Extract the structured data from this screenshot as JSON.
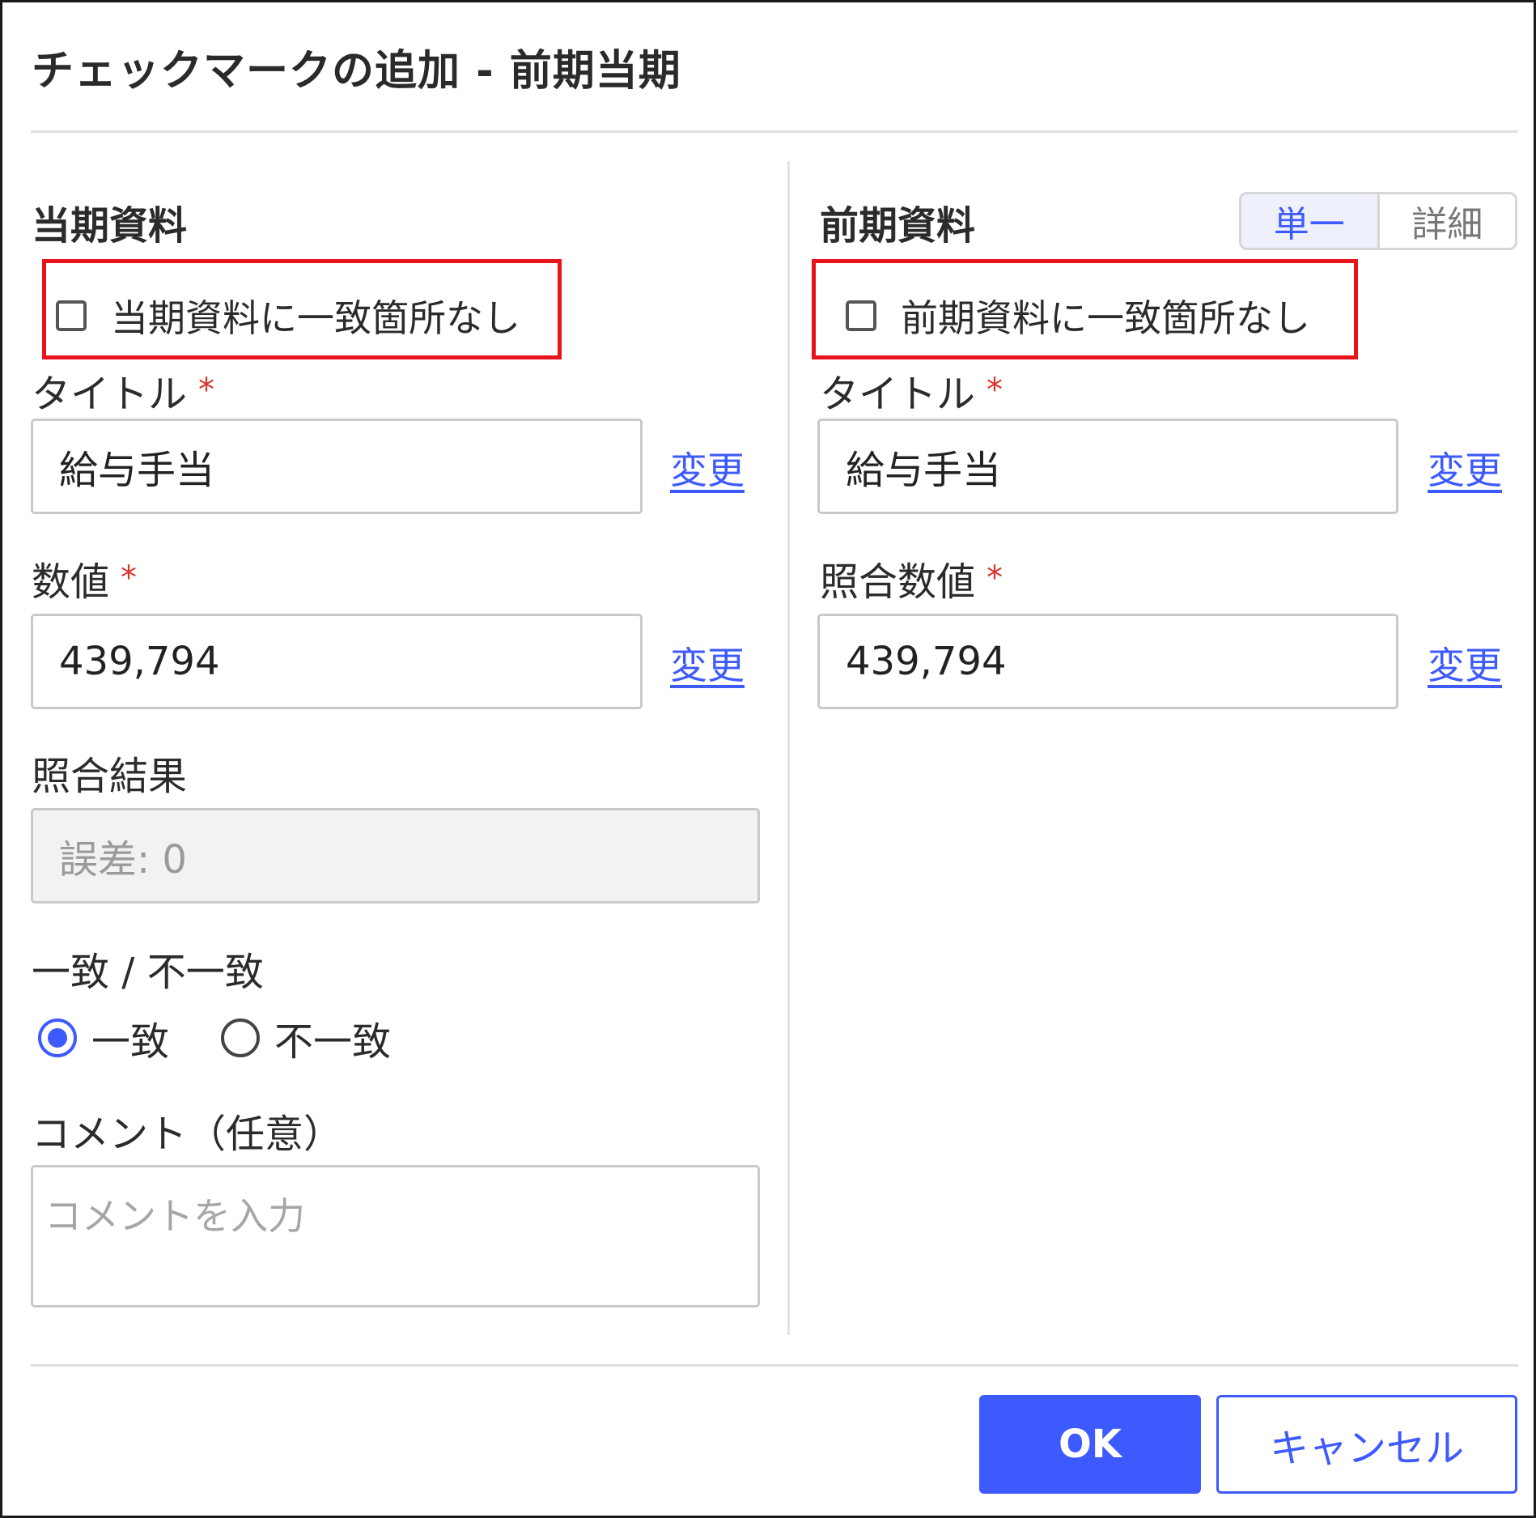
{
  "dialog": {
    "title": "チェックマークの追加 - 前期当期",
    "ok_label": "OK",
    "cancel_label": "キャンセル"
  },
  "current": {
    "section_title": "当期資料",
    "no_match_label": "当期資料に一致箇所なし",
    "title_label": "タイトル",
    "title_value": "給与手当",
    "title_change_link": "変更",
    "value_label": "数値",
    "value_value": "439,794",
    "value_change_link": "変更",
    "result_label": "照合結果",
    "result_value": "誤差: 0",
    "match_group_label": "一致 / 不一致",
    "match_options": [
      "一致",
      "不一致"
    ],
    "match_selected": "一致",
    "comment_label": "コメント（任意）",
    "comment_placeholder": "コメントを入力"
  },
  "previous": {
    "section_title": "前期資料",
    "mode_toggle": [
      "単一",
      "詳細"
    ],
    "mode_selected": "単一",
    "no_match_label": "前期資料に一致箇所なし",
    "title_label": "タイトル",
    "title_value": "給与手当",
    "title_change_link": "変更",
    "value_label": "照合数値",
    "value_value": "439,794",
    "value_change_link": "変更"
  },
  "required_mark": "*",
  "colors": {
    "accent": "#3d5afe",
    "required": "#d9342b",
    "highlight_box": "#e8141b"
  }
}
